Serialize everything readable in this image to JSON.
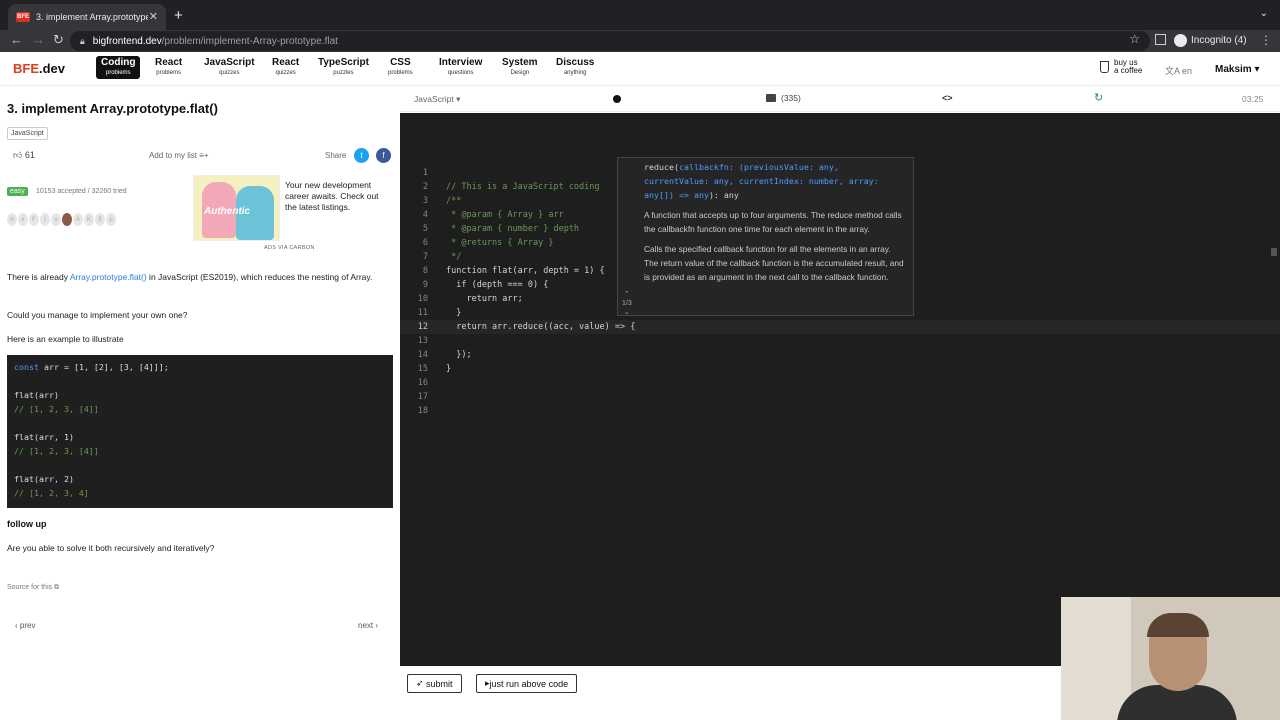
{
  "browser": {
    "tab_title": "3. implement Array.prototype.f",
    "tab_favicon": "BFE",
    "url_host": "bigfrontend.dev",
    "url_path": "/problem/implement-Array-prototype.flat",
    "profile": "Incognito (4)"
  },
  "site_nav": {
    "logo_prefix": "BFE",
    "logo_suffix": ".dev",
    "items": [
      {
        "label": "Coding",
        "sub": "problems"
      },
      {
        "label": "React",
        "sub": "problems"
      },
      {
        "label": "JavaScript",
        "sub": "quizzes"
      },
      {
        "label": "React",
        "sub": "quizzes"
      },
      {
        "label": "TypeScript",
        "sub": "puzzles"
      },
      {
        "label": "CSS",
        "sub": "problems"
      },
      {
        "label": "Interview",
        "sub": "questions"
      },
      {
        "label": "System",
        "sub": "Design"
      },
      {
        "label": "Discuss",
        "sub": "anything"
      }
    ],
    "coffee_line1": "buy us",
    "coffee_line2": "a coffee",
    "lang": "en",
    "user": "Maksim"
  },
  "problem": {
    "title": "3. implement Array.prototype.flat()",
    "tag": "JavaScript",
    "likes": "61",
    "add_to_list": "Add to my list",
    "share": "Share",
    "difficulty": "easy",
    "stats": "10153 accepted / 32260 tried",
    "badge_letters": [
      "b",
      "x",
      "F",
      "I",
      "x",
      "",
      "A",
      "K",
      "5",
      "p"
    ],
    "ad_text": "Your new development career awaits. Check out the latest listings.",
    "ad_image_word": "Authentic",
    "ad_carbon": "ADS VIA CARBON",
    "p1_before": "There is already ",
    "p1_link": "Array.prototype.flat()",
    "p1_after": " in JavaScript (ES2019), which reduces the nesting of Array.",
    "p2": "Could you manage to implement your own one?",
    "p3": "Here is an example to illustrate",
    "example": {
      "line1_kw": "const",
      "line1_rest": " arr = [1, [2], [3, [4]]];",
      "lines": [
        "flat(arr)",
        "// [1, 2, 3, [4]]",
        "flat(arr, 1)",
        "// [1, 2, 3, [4]]",
        "flat(arr, 2)",
        "// [1, 2, 3, 4]"
      ]
    },
    "follow_up": "follow up",
    "follow_up_text": "Are you able to solve it both recursively and iteratively?",
    "source": "Source for this",
    "prev": "prev",
    "next": "next"
  },
  "editor": {
    "language": "JavaScript",
    "comments": "(335)",
    "brackets": "<>",
    "timer": "03:25",
    "lines": [
      {
        "n": "1",
        "t": ""
      },
      {
        "n": "2",
        "t": "// This is a JavaScript coding"
      },
      {
        "n": "3",
        "t": "/**"
      },
      {
        "n": "4",
        "t": " * @param { Array } arr"
      },
      {
        "n": "5",
        "t": " * @param { number } depth"
      },
      {
        "n": "6",
        "t": " * @returns { Array }"
      },
      {
        "n": "7",
        "t": " */"
      },
      {
        "n": "8",
        "t": "function flat(arr, depth = 1) {"
      },
      {
        "n": "9",
        "t": "  if (depth === 0) {"
      },
      {
        "n": "10",
        "t": "    return arr;"
      },
      {
        "n": "11",
        "t": "  }"
      },
      {
        "n": "12",
        "t": "  return arr.reduce((acc, value) => {"
      },
      {
        "n": "13",
        "t": ""
      },
      {
        "n": "14",
        "t": "  });"
      },
      {
        "n": "15",
        "t": "}"
      },
      {
        "n": "16",
        "t": ""
      },
      {
        "n": "17",
        "t": ""
      },
      {
        "n": "18",
        "t": ""
      }
    ],
    "hover": {
      "sig_name": "reduce(",
      "sig_params": "callbackfn: (previousValue: any, currentValue: any, currentIndex: number, array: any[]) => any",
      "sig_end": "): any",
      "desc1": "A function that accepts up to four arguments. The reduce method calls the callbackfn function one time for each element in the array.",
      "desc2": "Calls the specified callback function for all the elements in an array. The return value of the callback function is the accumulated result, and is provided as an argument in the next call to the callback function.",
      "pager": "1/3"
    }
  },
  "actions": {
    "submit": "submit",
    "run": "just run above code"
  }
}
